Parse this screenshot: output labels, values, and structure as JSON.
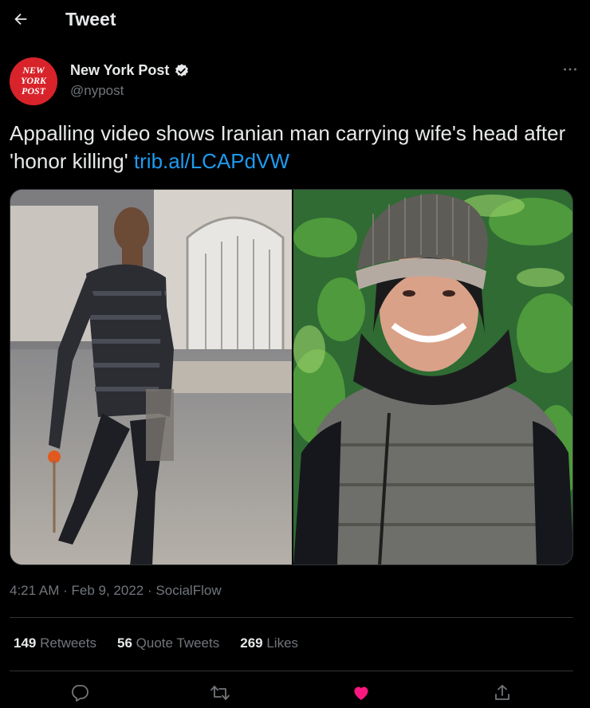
{
  "header": {
    "title": "Tweet",
    "back_icon": "arrow-left-icon"
  },
  "author": {
    "display_name": "New York Post",
    "handle": "@nypost",
    "verified": true,
    "avatar_text": [
      "NEW",
      "YORK",
      "POST"
    ],
    "avatar_color": "#d8232a"
  },
  "tweet": {
    "text": "Appalling video shows Iranian man carrying wife's head after 'honor killing'",
    "link": "trib.al/LCAPdVW"
  },
  "meta": {
    "time": "4:21 AM",
    "sep1": "·",
    "date": "Feb 9, 2022",
    "sep2": "·",
    "source": "SocialFlow"
  },
  "stats": [
    {
      "count": "149",
      "label": "Retweets"
    },
    {
      "count": "56",
      "label": "Quote Tweets"
    },
    {
      "count": "269",
      "label": "Likes"
    }
  ],
  "actions": {
    "reply_icon": "reply-icon",
    "retweet_icon": "retweet-icon",
    "like_icon": "heart-filled-icon",
    "share_icon": "share-icon",
    "like_color": "#f91880"
  },
  "colors": {
    "background": "#000000",
    "text": "#e7e9ea",
    "muted": "#71767b",
    "link": "#1d9bf0",
    "divider": "#2f3336"
  }
}
